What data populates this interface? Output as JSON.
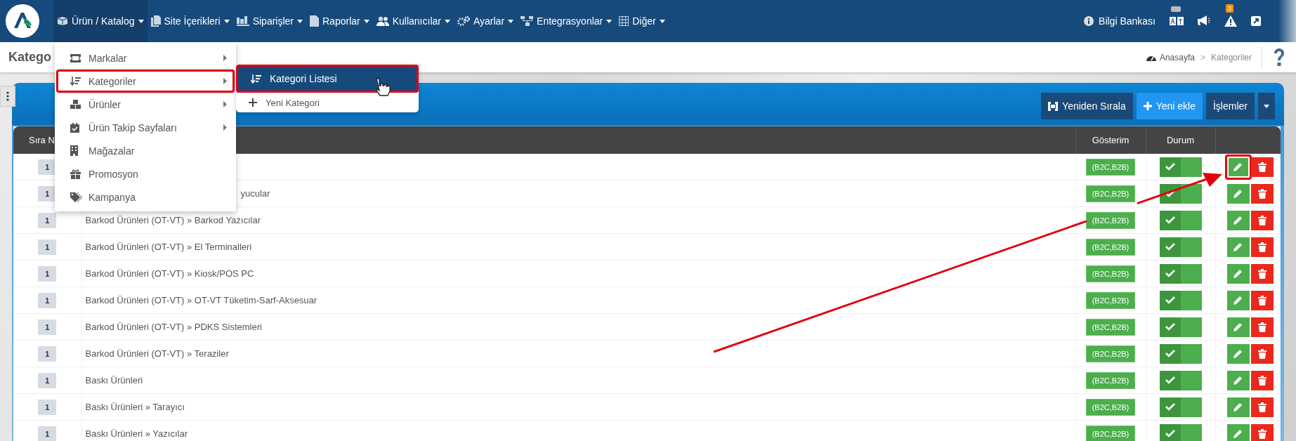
{
  "navbar": {
    "items": [
      {
        "label": "Ürün / Katalog",
        "selected": true
      },
      {
        "label": "Site İçerikleri",
        "selected": false
      },
      {
        "label": "Siparişler",
        "selected": false
      },
      {
        "label": "Raporlar",
        "selected": false
      },
      {
        "label": "Kullanıcılar",
        "selected": false
      },
      {
        "label": "Ayarlar",
        "selected": false
      },
      {
        "label": "Entegrasyonlar",
        "selected": false
      },
      {
        "label": "Diğer",
        "selected": false
      }
    ],
    "help_link": "Bilgi Bankası",
    "alert_badge": "3"
  },
  "page_header": {
    "title": "Katego",
    "breadcrumb": [
      "Anasayfa",
      "Kategoriler"
    ],
    "breadcrumb_separator": ">"
  },
  "dropdown": {
    "items": [
      {
        "label": "Markalar",
        "has_submenu": true,
        "highlighted": false
      },
      {
        "label": "Kategoriler",
        "has_submenu": true,
        "highlighted": true
      },
      {
        "label": "Ürünler",
        "has_submenu": true,
        "highlighted": false
      },
      {
        "label": "Ürün Takip Sayfaları",
        "has_submenu": true,
        "highlighted": false
      },
      {
        "label": "Mağazalar",
        "has_submenu": false,
        "highlighted": false
      },
      {
        "label": "Promosyon",
        "has_submenu": false,
        "highlighted": false
      },
      {
        "label": "Kampanya",
        "has_submenu": false,
        "highlighted": false
      }
    ]
  },
  "submenu": {
    "items": [
      {
        "label": "Kategori Listesi",
        "selected": true
      },
      {
        "label": "Yeni Kategori",
        "selected": false
      }
    ]
  },
  "toolbar": {
    "buttons": [
      "Yeniden Sırala",
      "Yeni ekle",
      "İşlemler"
    ]
  },
  "table": {
    "columns": {
      "order": "Sıra N",
      "display": "Gösterim",
      "status": "Durum"
    },
    "rows": [
      {
        "order": "1",
        "display": "(B2C,B2B)",
        "active": true,
        "edit_highlighted": true
      },
      {
        "order": "1",
        "name": "yucular",
        "name_partly_covered": true,
        "display": "(B2C,B2B)",
        "active": true,
        "edit_highlighted": false
      },
      {
        "order": "1",
        "name": "Barkod Ürünleri (OT-VT) » Barkod Yazıcılar",
        "display": "(B2C,B2B)",
        "active": true,
        "edit_highlighted": false
      },
      {
        "order": "1",
        "name": "Barkod Ürünleri (OT-VT) » El Terminalleri",
        "display": "(B2C,B2B)",
        "active": true,
        "edit_highlighted": false
      },
      {
        "order": "1",
        "name": "Barkod Ürünleri (OT-VT) » Kiosk/POS PC",
        "display": "(B2C,B2B)",
        "active": true,
        "edit_highlighted": false
      },
      {
        "order": "1",
        "name": "Barkod Ürünleri (OT-VT) » OT-VT Tüketim-Sarf-Aksesuar",
        "display": "(B2C,B2B)",
        "active": true,
        "edit_highlighted": false
      },
      {
        "order": "1",
        "name": "Barkod Ürünleri (OT-VT) » PDKS Sistemleri",
        "display": "(B2C,B2B)",
        "active": true,
        "edit_highlighted": false
      },
      {
        "order": "1",
        "name": "Barkod Ürünleri (OT-VT) » Teraziler",
        "display": "(B2C,B2B)",
        "active": true,
        "edit_highlighted": false
      },
      {
        "order": "1",
        "name": "Baskı Ürünleri",
        "display": "(B2C,B2B)",
        "active": true,
        "edit_highlighted": false
      },
      {
        "order": "1",
        "name": "Baskı Ürünleri » Tarayıcı",
        "display": "(B2C,B2B)",
        "active": true,
        "edit_highlighted": false
      },
      {
        "order": "1",
        "name": "Baskı Ürünleri » Yazıcılar",
        "display": "(B2C,B2B)",
        "active": true,
        "edit_highlighted": false
      }
    ]
  }
}
